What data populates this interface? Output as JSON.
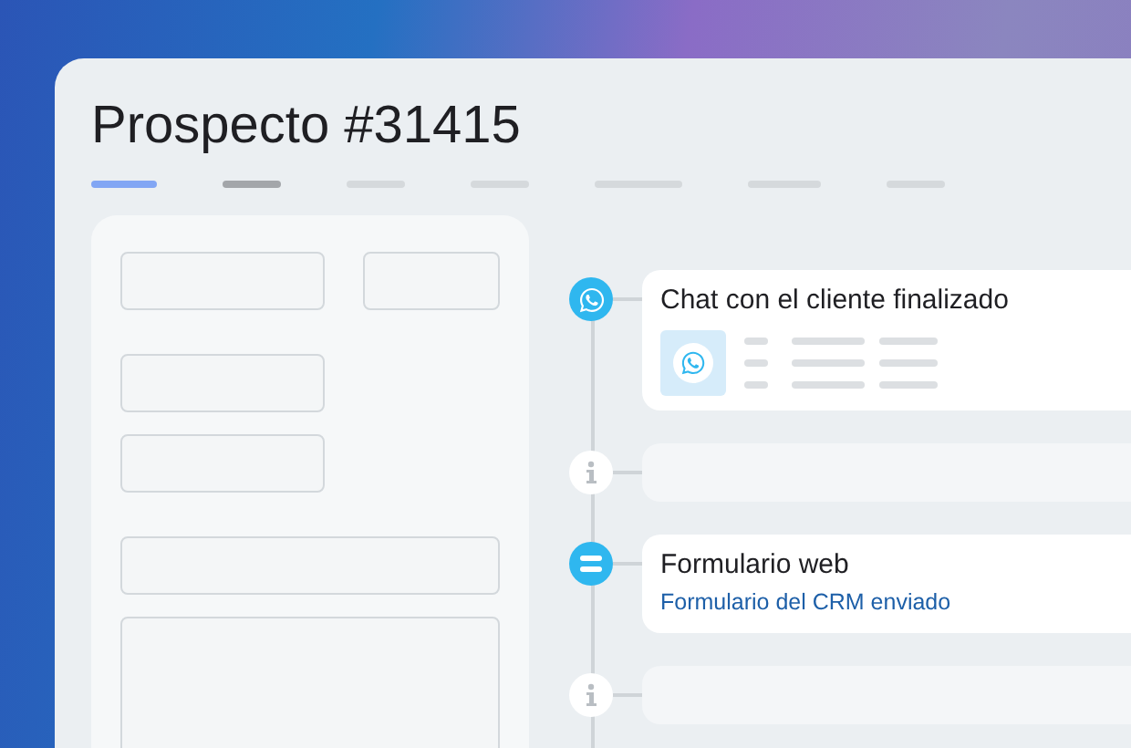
{
  "title": "Prospecto #31415",
  "tabs": [
    {
      "selected": true,
      "visited": false
    },
    {
      "selected": false,
      "visited": true
    },
    {
      "selected": false,
      "visited": false
    },
    {
      "selected": false,
      "visited": false
    },
    {
      "selected": false,
      "visited": false
    },
    {
      "selected": false,
      "visited": false
    },
    {
      "selected": false,
      "visited": false
    }
  ],
  "form": {
    "fields": [
      {
        "kind": "short"
      },
      {
        "kind": "tiny"
      },
      {
        "kind": "short"
      },
      {
        "kind": "short"
      },
      {
        "kind": "wide"
      },
      {
        "kind": "area"
      }
    ]
  },
  "timeline": [
    {
      "kind": "chat",
      "title": "Chat con el cliente finalizado"
    },
    {
      "kind": "note"
    },
    {
      "kind": "form",
      "title": "Formulario web",
      "link": "Formulario del CRM enviado"
    },
    {
      "kind": "note"
    }
  ]
}
